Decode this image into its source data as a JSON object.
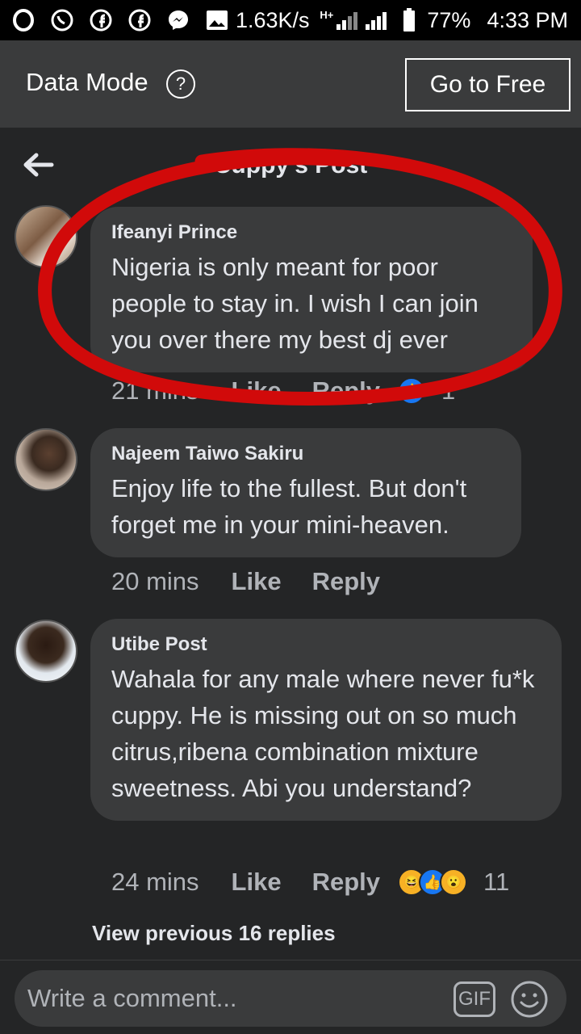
{
  "status_bar": {
    "speed": "1.63K/s",
    "network": "H+",
    "battery": "77%",
    "time": "4:33 PM"
  },
  "data_mode": {
    "title": "Data Mode",
    "help": "?",
    "button": "Go to Free"
  },
  "header": {
    "title": "Cuppy's Post"
  },
  "comments": [
    {
      "author": "Ifeanyi Prince",
      "text": "Nigeria is only meant for poor people to stay in. I wish I can join you over there my best dj ever",
      "time": "21 mins",
      "like": "Like",
      "reply": "Reply",
      "reaction_count": "1"
    },
    {
      "author": "Najeem Taiwo Sakiru",
      "text": "Enjoy life to the fullest. But don't forget me in your mini-heaven.",
      "time": "20 mins",
      "like": "Like",
      "reply": "Reply"
    },
    {
      "author": "Utibe Post",
      "text": "Wahala for any male where never fu*k cuppy. He is missing out on so much citrus,ribena combination mixture sweetness. Abi you understand?",
      "time": "24 mins",
      "like": "Like",
      "reply": "Reply",
      "reaction_count": "11"
    }
  ],
  "view_previous": "View previous 16 replies",
  "composer": {
    "placeholder": "Write a comment...",
    "gif": "GIF"
  },
  "colors": {
    "annotation": "#d10a0a",
    "bubble": "#3a3b3c",
    "background": "#242526",
    "like_blue": "#1877f2"
  }
}
